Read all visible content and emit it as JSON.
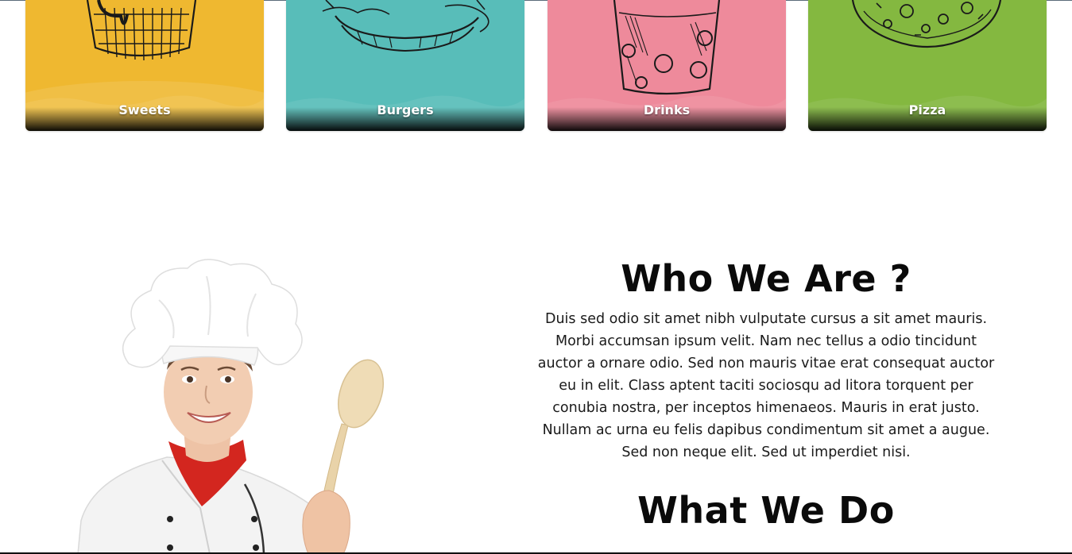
{
  "categories": [
    {
      "label": "Sweets",
      "color": "#efb830"
    },
    {
      "label": "Burgers",
      "color": "#58bdb9"
    },
    {
      "label": "Drinks",
      "color": "#ee8a9b"
    },
    {
      "label": "Pizza",
      "color": "#84b840"
    }
  ],
  "about": {
    "title": "Who We Are ?",
    "body": "Duis sed odio sit amet nibh vulputate cursus a sit amet mauris. Morbi accumsan ipsum velit. Nam nec tellus a odio tincidunt auctor a ornare odio. Sed non mauris vitae erat consequat auctor eu in elit. Class aptent taciti sociosqu ad litora torquent per conubia nostra, per inceptos himenaeos. Mauris in erat justo. Nullam ac urna eu felis dapibus condimentum sit amet a augue. Sed non neque elit. Sed ut imperdiet nisi."
  },
  "what_we_do": {
    "title": "What We Do"
  }
}
